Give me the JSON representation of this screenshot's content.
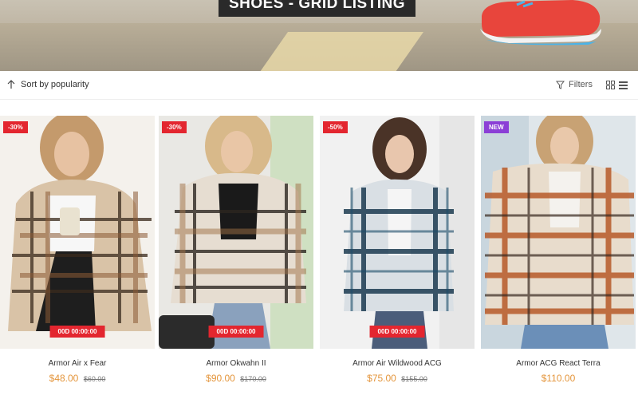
{
  "hero": {
    "title": "SHOES - GRID LISTING"
  },
  "toolbar": {
    "sort_label": "Sort by popularity",
    "filters_label": "Filters"
  },
  "products": [
    {
      "badge": "-30%",
      "timer": "00D 00:00:00",
      "name": "Armor Air x Fear",
      "price": "$48.00",
      "old_price": "$60.00"
    },
    {
      "badge": "-30%",
      "timer": "00D 00:00:00",
      "name": "Armor Okwahn II",
      "price": "$90.00",
      "old_price": "$170.00"
    },
    {
      "badge": "-50%",
      "timer": "00D 00:00:00",
      "name": "Armor Air Wildwood ACG",
      "price": "$75.00",
      "old_price": "$155.00"
    },
    {
      "badge": "NEW",
      "name": "Armor ACG React Terra",
      "price": "$110.00"
    }
  ],
  "colors": {
    "sale_badge": "#e3262f",
    "new_badge": "#8b3fd6",
    "price": "#e4953b"
  }
}
